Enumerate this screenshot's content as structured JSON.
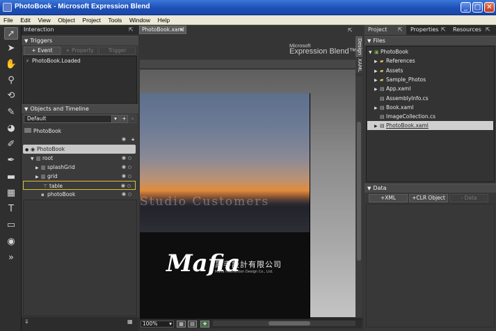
{
  "window": {
    "title": "PhotoBook - Microsoft Expression Blend",
    "minimize": "_",
    "maximize": "□",
    "close": "✕"
  },
  "menu": [
    "File",
    "Edit",
    "View",
    "Object",
    "Project",
    "Tools",
    "Window",
    "Help"
  ],
  "interaction": {
    "tab": "Interaction",
    "triggers_header": "Triggers",
    "buttons": {
      "event": "+ Event",
      "property": "+ Property",
      "trigger": "Trigger"
    },
    "trigger_item": "PhotoBook.Loaded",
    "objects_header": "Objects and Timeline",
    "timeline_select": "Default",
    "timeline_add": "+",
    "timeline_close": "×",
    "document": "PhotoBook",
    "tree": [
      {
        "label": "PhotoBook",
        "depth": 0,
        "selected": true
      },
      {
        "label": "root",
        "depth": 1
      },
      {
        "label": "splashGrid",
        "depth": 2
      },
      {
        "label": "grid",
        "depth": 2
      },
      {
        "label": "table",
        "depth": 2,
        "highlight": true
      },
      {
        "label": "photoBook",
        "depth": 2
      }
    ]
  },
  "document": {
    "tab": "PhotoBook.xaml",
    "tab_close": "×",
    "brand_top": "Microsoft",
    "brand_name": "Expression Blend™",
    "side_tabs": [
      "Design",
      "XAML"
    ],
    "art_text": "Studio  Customers",
    "logo": "Mafia",
    "logo_cn": "黑手設計有限公司",
    "logo_en": "Mafia Interaction Design Co., Ltd.",
    "zoom": "100%"
  },
  "right_panel": {
    "tabs": [
      "Project",
      "Properties",
      "Resources"
    ],
    "files_header": "Files",
    "files": [
      {
        "label": "PhotoBook",
        "depth": 0,
        "type": "project"
      },
      {
        "label": "References",
        "depth": 1,
        "type": "folder"
      },
      {
        "label": "Assets",
        "depth": 1,
        "type": "folder"
      },
      {
        "label": "Sample_Photos",
        "depth": 1,
        "type": "folder"
      },
      {
        "label": "App.xaml",
        "depth": 1,
        "type": "file"
      },
      {
        "label": "AssemblyInfo.cs",
        "depth": 1,
        "type": "file"
      },
      {
        "label": "Book.xaml",
        "depth": 1,
        "type": "file"
      },
      {
        "label": "ImageCollection.cs",
        "depth": 1,
        "type": "file"
      },
      {
        "label": "PhotoBook.xaml",
        "depth": 1,
        "type": "file",
        "selected": true
      }
    ],
    "data_header": "Data",
    "data_buttons": {
      "xml": "+XML",
      "clr": "+CLR Object",
      "data": "- Data"
    }
  }
}
